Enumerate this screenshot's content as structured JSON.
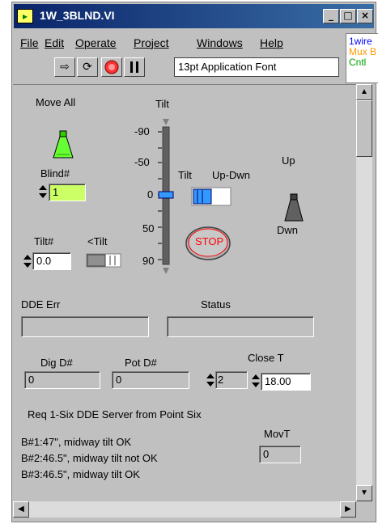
{
  "window": {
    "title": "1W_3BLND.VI",
    "icon_label": "▸",
    "minimize_label": "_",
    "maximize_label": "□",
    "close_label": "×"
  },
  "menubar": {
    "items": [
      "File",
      "Edit",
      "Operate",
      "Project",
      "Windows",
      "Help"
    ]
  },
  "toolbar": {
    "font_name": "13pt Application Font"
  },
  "palette": {
    "lines": [
      "1wire",
      "Mux B",
      "Cntl"
    ],
    "colors": [
      "#0000ff",
      "#ff9900",
      "#00a000"
    ]
  },
  "panel": {
    "move_all_label": "Move All",
    "blind_label": "Blind#",
    "blind_value": "1",
    "tilt_label": "Tilt",
    "tilt_slider_value": 0,
    "tilt_scale": [
      "-90",
      "-50",
      "0",
      "50",
      "90"
    ],
    "tilt_updwn_label": "Tilt",
    "updwn_label": "Up-Dwn",
    "up_label": "Up",
    "dwn_label": "Dwn",
    "stop_label": "STOP",
    "tilt_num_label": "Tilt#",
    "tilt_num_value": "0.0",
    "lt_tilt_label": "<Tilt",
    "dde_err_label": "DDE Err",
    "status_label": "Status",
    "dig_label": "Dig D#",
    "dig_value": "0",
    "pot_label": "Pot D#",
    "pot_value": "0",
    "close_label": "Close T",
    "close_count": "2",
    "close_value": "18.00",
    "req_text": "Req 1-Six DDE Server from Point Six",
    "movt_label": "MovT",
    "movt_value": "0",
    "notes": [
      "B#1:47\", midway tilt OK",
      "B#2:46.5\", midway tilt not OK",
      "B#3:46.5\", midway tilt OK"
    ]
  },
  "colors": {
    "panel_bg": "#c0c0c0",
    "title_bg": "#0a246a",
    "stop_red": "#ff0000",
    "green_button": "#66ff33",
    "blind_field": "#ccff66",
    "slider_blue": "#3399ff"
  }
}
